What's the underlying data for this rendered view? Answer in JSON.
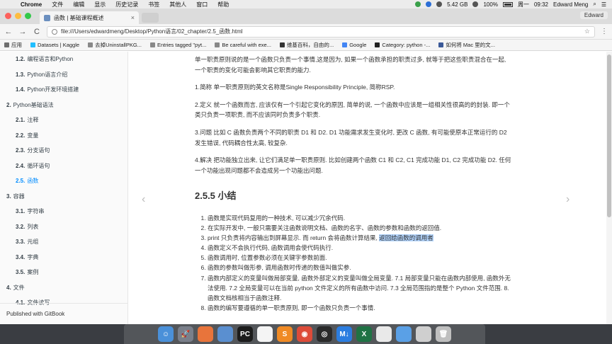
{
  "menubar": {
    "apple": "",
    "items": [
      "Chrome",
      "文件",
      "编辑",
      "显示",
      "历史记录",
      "书签",
      "其他人",
      "窗口",
      "帮助"
    ],
    "status": "5.42 GB",
    "battery": "100%",
    "day": "周一",
    "time": "09:32",
    "user": "Edward Meng"
  },
  "browser": {
    "tab_title": "函数 | 基础课程概述",
    "tab_close": "×",
    "user_chip": "Edward",
    "url": "file:///Users/edwardmeng/Desktop/Python语言/02_chapter/2.5_函数.html",
    "back": "←",
    "forward": "→",
    "reload": "C",
    "star": "☆",
    "menu": "⋮",
    "bookmarks": [
      {
        "label": "应用",
        "icon_color": "#6e6e6e"
      },
      {
        "label": "Datasets | Kaggle",
        "icon_color": "#20beff"
      },
      {
        "label": "去掉UninstallPKG...",
        "icon_color": "#888888"
      },
      {
        "label": "Entries tagged \"pyt...",
        "icon_color": "#888888"
      },
      {
        "label": "Be careful with exe...",
        "icon_color": "#888888"
      },
      {
        "label": "维基百科，自由的...",
        "icon_color": "#333333"
      },
      {
        "label": "Google",
        "icon_color": "#4285f4"
      },
      {
        "label": "Category: python -...",
        "icon_color": "#222222"
      },
      {
        "label": "如何将 Mac 里的文...",
        "icon_color": "#3b5998"
      }
    ]
  },
  "sidebar": {
    "items": [
      {
        "num": "1.2.",
        "label": "编程语言和Python",
        "level": 2
      },
      {
        "num": "1.3.",
        "label": "Python语言介绍",
        "level": 2
      },
      {
        "num": "1.4.",
        "label": "Python开发环境搭建",
        "level": 2
      },
      {
        "num": "2.",
        "label": "Python基础语法",
        "level": 1
      },
      {
        "num": "2.1.",
        "label": "注释",
        "level": 2
      },
      {
        "num": "2.2.",
        "label": "变量",
        "level": 2
      },
      {
        "num": "2.3.",
        "label": "分支语句",
        "level": 2
      },
      {
        "num": "2.4.",
        "label": "循环语句",
        "level": 2
      },
      {
        "num": "2.5.",
        "label": "函数",
        "level": 2,
        "active": true
      },
      {
        "num": "3.",
        "label": "容器",
        "level": 1
      },
      {
        "num": "3.1.",
        "label": "字符串",
        "level": 2
      },
      {
        "num": "3.2.",
        "label": "列表",
        "level": 2
      },
      {
        "num": "3.3.",
        "label": "元组",
        "level": 2
      },
      {
        "num": "3.4.",
        "label": "字典",
        "level": 2
      },
      {
        "num": "3.5.",
        "label": "案例",
        "level": 2
      },
      {
        "num": "4.",
        "label": "文件",
        "level": 1
      },
      {
        "num": "4.1.",
        "label": "文件读写",
        "level": 2
      }
    ],
    "footer": "Published with GitBook"
  },
  "article": {
    "paragraphs": [
      "单一职责原则说的是一个函数只负责一个事情,这是因为, 如果一个函数承担的职责过多, 就等于把这些职责混合在一起, 一个职责的变化可能会影响其它职责的能力.",
      "1.简称 单一职责原则的英文名称是Single Responsibility Principle, 简称RSP.",
      "2.定义 就一个函数而言, 应该仅有一个引起它变化的原因, 简单的说, 一个函数中应该是一组相关性很高的的封装. 即一个类只负责一项职责, 而不应该同时负责多个职责.",
      "3.问题 比如 C 函数负责两个不同的职责 D1 和 D2. D1 功能需求发生变化时, 更改 C 函数, 有可能使原本正常运行的 D2 发生错误, 代码耦合性太高, 较复杂.",
      "4.解决 把功能独立出来, 让它们满足单一职责原则. 比如创建两个函数 C1 和 C2, C1 完成功能 D1, C2 完成功能 D2. 任何一个功能出现问题都不会造成另一个功能出问题."
    ],
    "heading": "2.5.5 小结",
    "summary": [
      "函数是实现代码复用的一种技术, 可以减少冗余代码.",
      "在实际开发中, 一般只需要关注函数说明文档、函数的名字、函数的参数和函数的返回值.",
      "print 只负责将内容输出到屏幕显示. 而 return 会将函数计算结果, ",
      "函数定义不会执行代码, 函数调用会使代码执行.",
      "函数调用时, 位置参数必须在关键字参数前面.",
      "函数的参数叫做形参, 调用函数时传递的数值叫做实参.",
      "函数内部定义的变量叫做局部变量, 函数外部定义的变量叫做全局变量. 7.1 局部变量只能在函数内部使用, 函数外无法使用. 7.2 全局变量可以在当前 python 文件定义的所有函数中访问. 7.3 全局范围指的是整个 Python 文件范围. 8.函数文档核相当于函数注释.",
      "函数的编写要遵循的单一职责原则, 即一个函数只负责一个事情."
    ],
    "highlighted": "返回给函数的调用者",
    "prev_arrow": "‹",
    "next_arrow": "›"
  },
  "dock": {
    "apps": [
      {
        "name": "finder-icon",
        "color": "#4a90d9",
        "glyph": "☺"
      },
      {
        "name": "launchpad-icon",
        "color": "#7a7f8a",
        "glyph": "🚀"
      },
      {
        "name": "sublime-merge-icon",
        "color": "#e8743b",
        "glyph": ""
      },
      {
        "name": "files-icon",
        "color": "#5a8fd0",
        "glyph": ""
      },
      {
        "name": "pycharm-icon",
        "color": "#1c1c1c",
        "glyph": "PC"
      },
      {
        "name": "calendar-icon",
        "color": "#f4f4f4",
        "glyph": ""
      },
      {
        "name": "sublime-text-icon",
        "color": "#f08a24",
        "glyph": "S"
      },
      {
        "name": "chrome-icon",
        "color": "#dd4b39",
        "glyph": "◉"
      },
      {
        "name": "obs-icon",
        "color": "#2a2a2a",
        "glyph": "◎"
      },
      {
        "name": "markdown-icon",
        "color": "#2b7de0",
        "glyph": "M↓"
      },
      {
        "name": "excel-icon",
        "color": "#1f7244",
        "glyph": "X"
      },
      {
        "name": "notes-icon",
        "color": "#e9e9e9",
        "glyph": ""
      },
      {
        "name": "folder-icon",
        "color": "#5aa0e6",
        "glyph": ""
      },
      {
        "name": "documents-icon",
        "color": "#cfcfcf",
        "glyph": ""
      },
      {
        "name": "trash-icon",
        "color": "#bfbfbf",
        "glyph": "🗑"
      }
    ]
  }
}
